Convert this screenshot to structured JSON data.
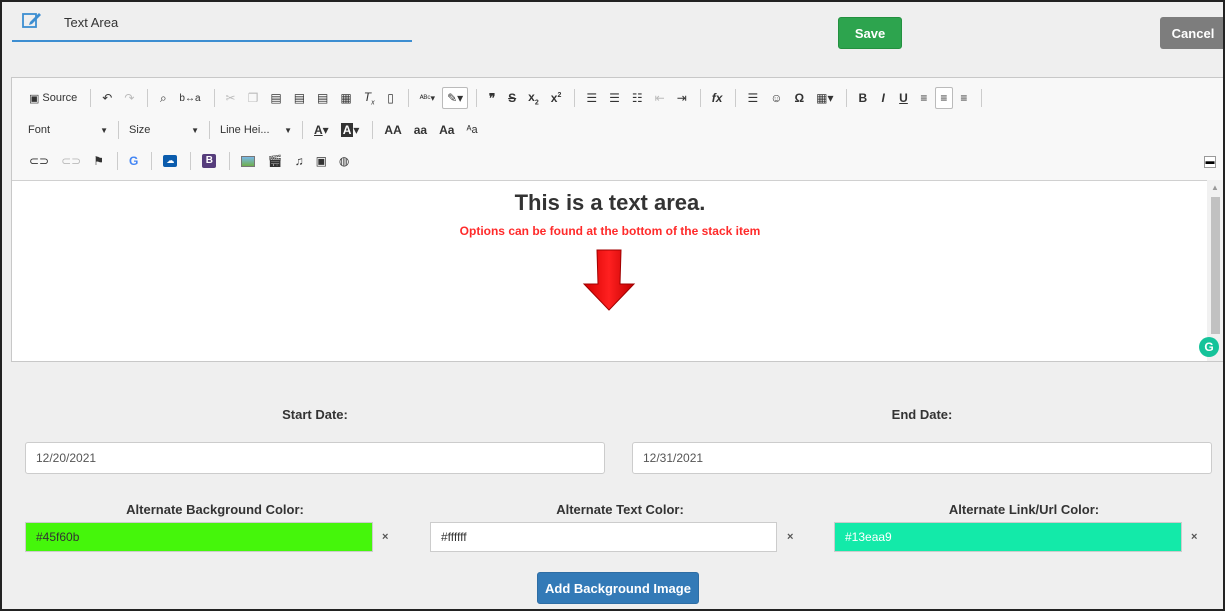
{
  "header": {
    "title": "Text Area",
    "save_label": "Save",
    "cancel_label": "Cancel"
  },
  "toolbar": {
    "source_label": "Source",
    "font_label": "Font",
    "size_label": "Size",
    "line_height_label": "Line Hei...",
    "icons_row1": [
      "undo-icon",
      "redo-icon",
      "find-icon",
      "replace-icon",
      "cut-icon",
      "copy-icon",
      "paste-icon",
      "paste-text-icon",
      "paste-word-icon",
      "templates-icon",
      "remove-format-icon",
      "select-all-icon",
      "spellcheck-icon",
      "format-icon",
      "blockquote-icon",
      "strike-icon",
      "subscript-icon",
      "superscript-icon",
      "numbered-list-icon",
      "bullet-list-icon",
      "decrease-indent-icon",
      "increase-indent-icon",
      "formula-icon",
      "horizontal-line-icon",
      "smiley-icon",
      "special-char-icon",
      "table-icon",
      "bold-icon",
      "italic-icon",
      "underline-icon",
      "align-left-icon",
      "align-center-icon",
      "align-right-icon"
    ],
    "icons_row3": [
      "link-icon",
      "unlink-icon",
      "anchor-icon",
      "google-icon",
      "onedrive-icon",
      "bootstrap-icon",
      "image-icon",
      "video-icon",
      "audio-icon",
      "embed-icon",
      "web-icon"
    ]
  },
  "editor": {
    "heading": "This is a text area.",
    "subtext": "Options can be found at the bottom of the stack item",
    "arrow_color": "#ff1a1a"
  },
  "form": {
    "start_date_label": "Start Date:",
    "start_date_value": "12/20/2021",
    "end_date_label": "End Date:",
    "end_date_value": "12/31/2021",
    "alt_bg_label": "Alternate Background Color:",
    "alt_bg_value": "#45f60b",
    "alt_text_label": "Alternate Text Color:",
    "alt_text_value": "#ffffff",
    "alt_link_label": "Alternate Link/Url Color:",
    "alt_link_value": "#13eaa9",
    "clear_symbol": "×",
    "add_bg_image_label": "Add Background Image"
  },
  "colors": {
    "save": "#2da44e",
    "cancel": "#7d7d7d",
    "primary": "#337ab7",
    "alt_bg": "#45f60b",
    "alt_text": "#ffffff",
    "alt_link": "#13eaa9"
  }
}
